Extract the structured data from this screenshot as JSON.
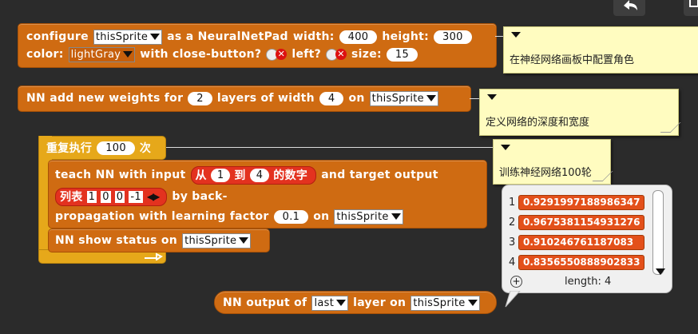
{
  "configure_block": {
    "configure": "configure",
    "sprite": "thisSprite",
    "as_a": "as a NeuralNetPad",
    "width": "width:",
    "width_val": "400",
    "height": "height:",
    "height_val": "300",
    "color": "color:",
    "color_val": "lightGray",
    "close_button": "with close-button?",
    "left": "left?",
    "size": "size:",
    "size_val": "15"
  },
  "add_weights_block": {
    "prefix": "NN add new weights for",
    "layers_val": "2",
    "layers_of_width": "layers of width",
    "width_val": "4",
    "on": "on",
    "sprite": "thisSprite"
  },
  "repeat_block": {
    "label": "重复执行",
    "count": "100",
    "suffix": "次"
  },
  "teach_block": {
    "teach": "teach NN with input",
    "from": "从",
    "from_val": "1",
    "to": "到",
    "to_val": "4",
    "numbers": "的数字",
    "target": "and target output",
    "list": "列表",
    "list_items": [
      "1",
      "0",
      "0",
      "-1"
    ],
    "by_back": "by back-",
    "propagation": "propagation with learning factor",
    "factor_val": "0.1",
    "on": "on",
    "sprite": "thisSprite"
  },
  "show_status_block": {
    "label": "NN show status on",
    "sprite": "thisSprite"
  },
  "output_block": {
    "prefix": "NN output of",
    "which": "last",
    "layer_on": "layer on",
    "sprite": "thisSprite"
  },
  "comments": {
    "c1": "在神经网络画板中配置角色",
    "c2": "定义网络的深度和宽度",
    "c3": "训练神经网络100轮"
  },
  "result_list": {
    "items": [
      {
        "index": "1",
        "value": "0.9291997188986347"
      },
      {
        "index": "2",
        "value": "0.9675381154931276"
      },
      {
        "index": "3",
        "value": "0.910246761187083"
      },
      {
        "index": "4",
        "value": "0.8356550888902833"
      }
    ],
    "length": "length: 4"
  },
  "colors": {
    "background": "#2b2b2b",
    "block_orange": "#cf6b12",
    "reporter_red": "#e3321f",
    "comment_yellow": "#fffcc0"
  }
}
